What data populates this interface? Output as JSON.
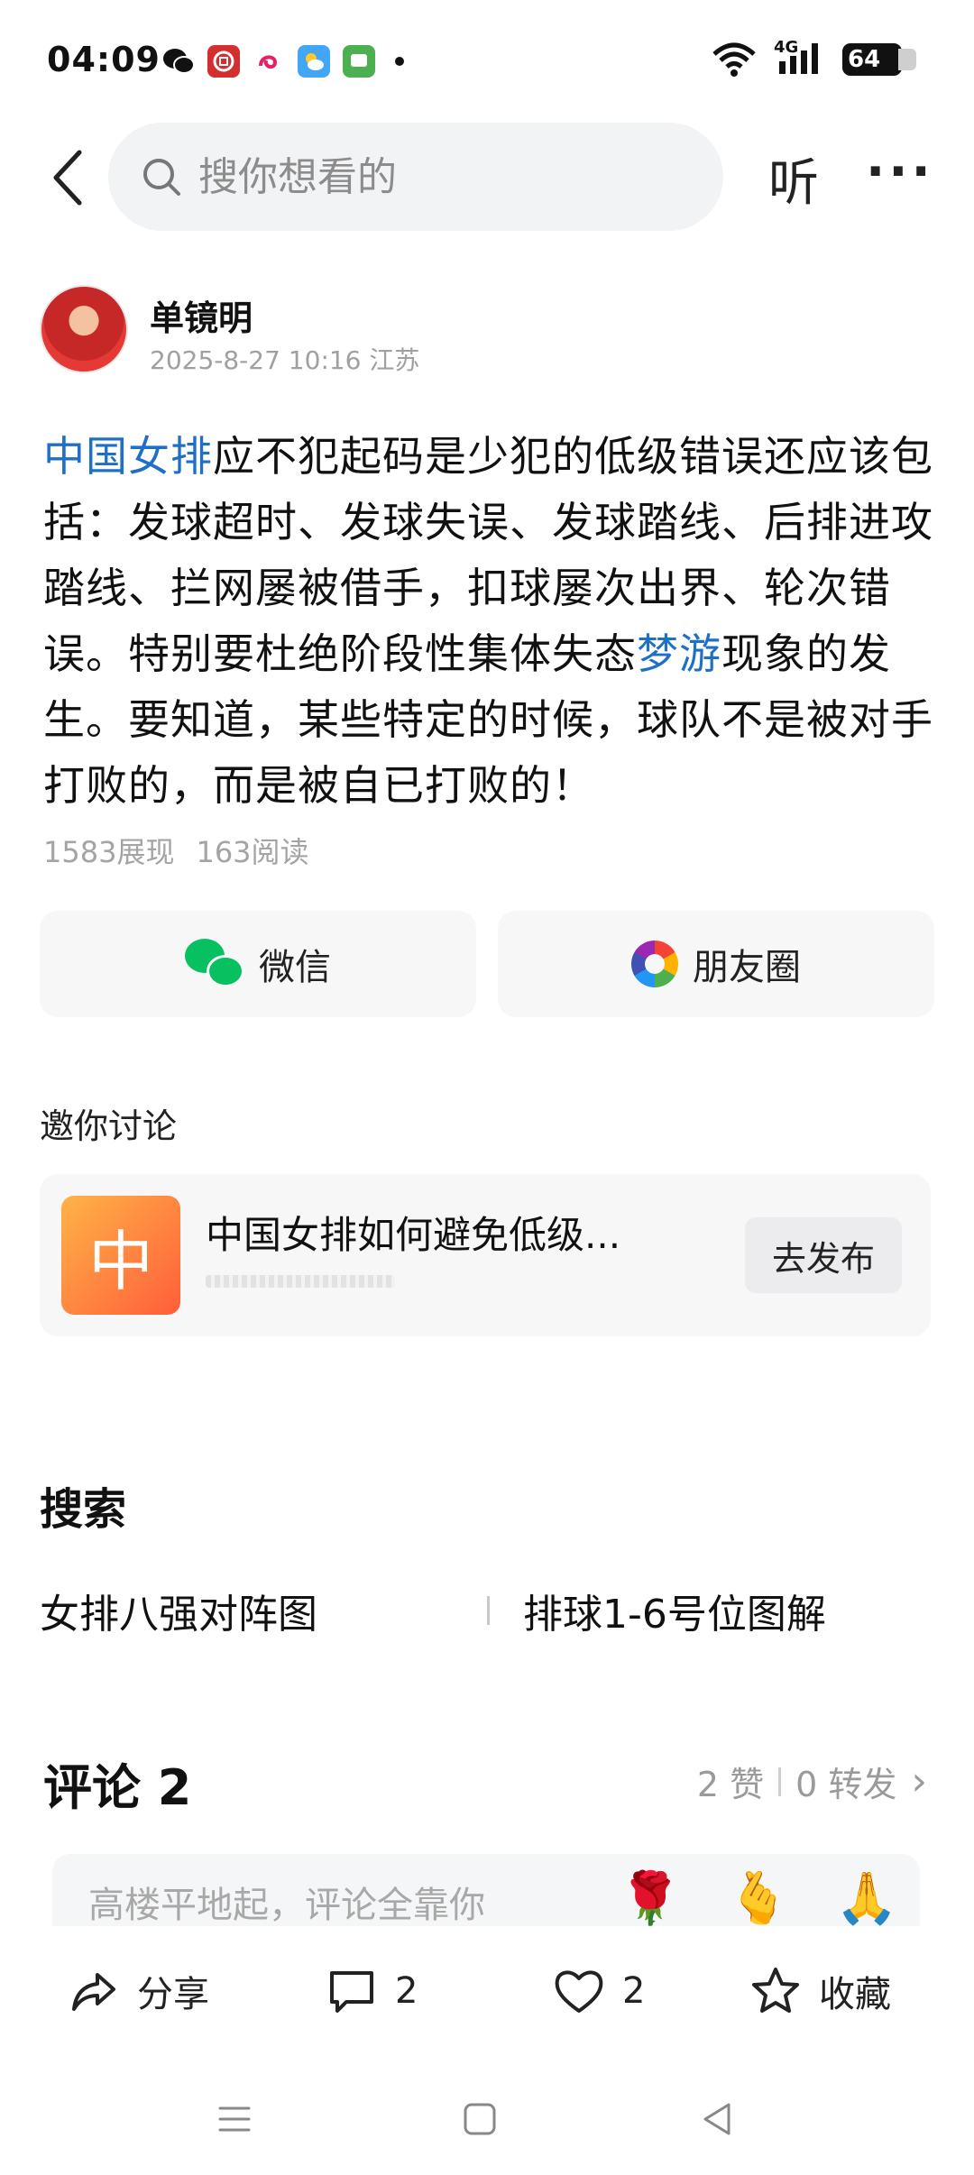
{
  "status_bar": {
    "time": "04:09",
    "battery": "64",
    "network": "4G"
  },
  "nav": {
    "search_placeholder": "搜你想看的",
    "listen_label": "听",
    "more_label": "···"
  },
  "author": {
    "name": "单镜明",
    "meta": "2025-8-27 10:16 江苏"
  },
  "post": {
    "link_topic": "中国女排",
    "text_part1": "应不犯起码是少犯的低级错误还应该包括：发球超时、发球失误、发球踏线、后排进攻踏线、拦网屡被借手，扣球屡次出界、轮次错误。特别要杜绝阶段性集体失态",
    "link_word": "梦游",
    "text_part2": "现象的发生。要知道，某些特定的时候，球队不是被对手打败的，而是被自已打败的！",
    "impressions": "1583展现",
    "reads": "163阅读"
  },
  "share": {
    "wechat_label": "微信",
    "moments_label": "朋友圈"
  },
  "discuss": {
    "title": "邀你讨论",
    "icon_char": "中",
    "topic": "中国女排如何避免低级...",
    "publish_label": "去发布"
  },
  "search_section": {
    "title": "搜索",
    "left_term": "女排八强对阵图",
    "right_term": "排球1-6号位图解"
  },
  "comments": {
    "title": "评论 2",
    "likes": "2 赞",
    "reposts": "0 转发",
    "chevron": "›",
    "placeholder": "高楼平地起，评论全靠你",
    "emojis": [
      "🌹",
      "🫰",
      "🙏"
    ]
  },
  "actions": {
    "share_label": "分享",
    "comment_count": "2",
    "like_count": "2",
    "collect_label": "收藏"
  },
  "colors": {
    "link": "#1f6fc7",
    "wechat_green": "#07c160"
  }
}
